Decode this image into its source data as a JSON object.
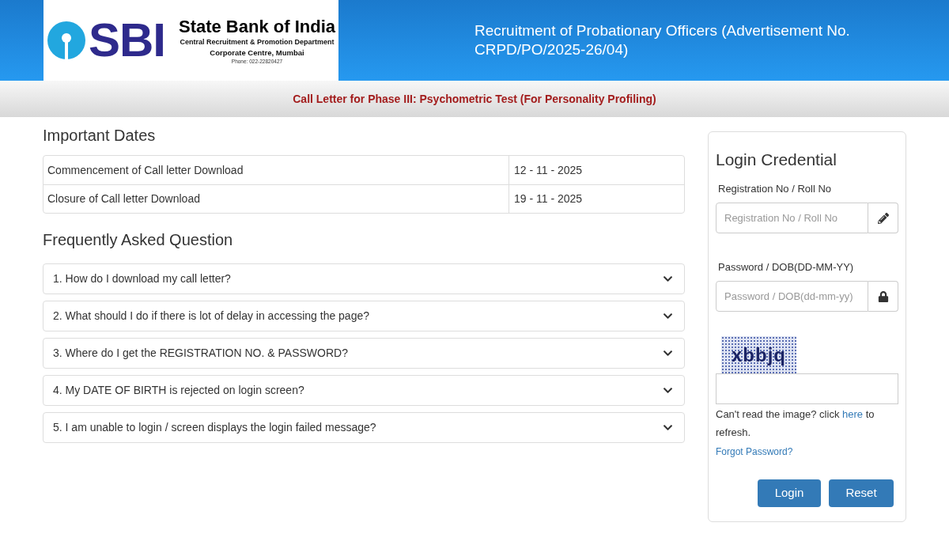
{
  "header": {
    "logo": {
      "letters": "SBI",
      "bank_name": "State Bank of India",
      "department": "Central Recruitment & Promotion Department",
      "office": "Corporate Centre, Mumbai",
      "phone": "Phone: 022-22820427"
    },
    "title": "Recruitment of Probationary Officers (Advertisement No. CRPD/PO/2025-26/04)"
  },
  "subheader": {
    "title": "Call Letter for Phase III: Psychometric Test (For Personality Profiling)"
  },
  "important_dates": {
    "heading": "Important Dates",
    "rows": [
      {
        "event": "Commencement of Call letter Download",
        "date": "12 - 11 - 2025"
      },
      {
        "event": "Closure of Call letter Download",
        "date": "19 - 11 - 2025"
      }
    ]
  },
  "faq": {
    "heading": "Frequently Asked Question",
    "items": [
      {
        "question": "1. How do I download my call letter?",
        "expanded": false
      },
      {
        "question": "2. What should I do if there is lot of delay in accessing the page?",
        "expanded": false
      },
      {
        "question": "3. Where do I get the REGISTRATION NO. & PASSWORD?",
        "expanded": false
      },
      {
        "question": "4. My DATE OF BIRTH is rejected on login screen?",
        "expanded": false
      },
      {
        "question": "5. I am unable to login / screen displays the login failed message?",
        "expanded": false
      }
    ]
  },
  "login": {
    "heading": "Login Credential",
    "fields": [
      {
        "kind": "text",
        "label": "Registration No / Roll No",
        "placeholder": "Registration No / Roll No"
      },
      {
        "kind": "password",
        "label": "Password / DOB(DD-MM-YY)",
        "placeholder": "Password / DOB(dd-mm-yy)"
      }
    ],
    "captcha": {
      "text": "xbbjq"
    },
    "refresh_hint": {
      "before": "Can't read the image? click",
      "link": "here",
      "after": "to refresh."
    },
    "forgot_password": "Forgot Password?",
    "buttons": [
      "Login",
      "Reset"
    ]
  }
}
